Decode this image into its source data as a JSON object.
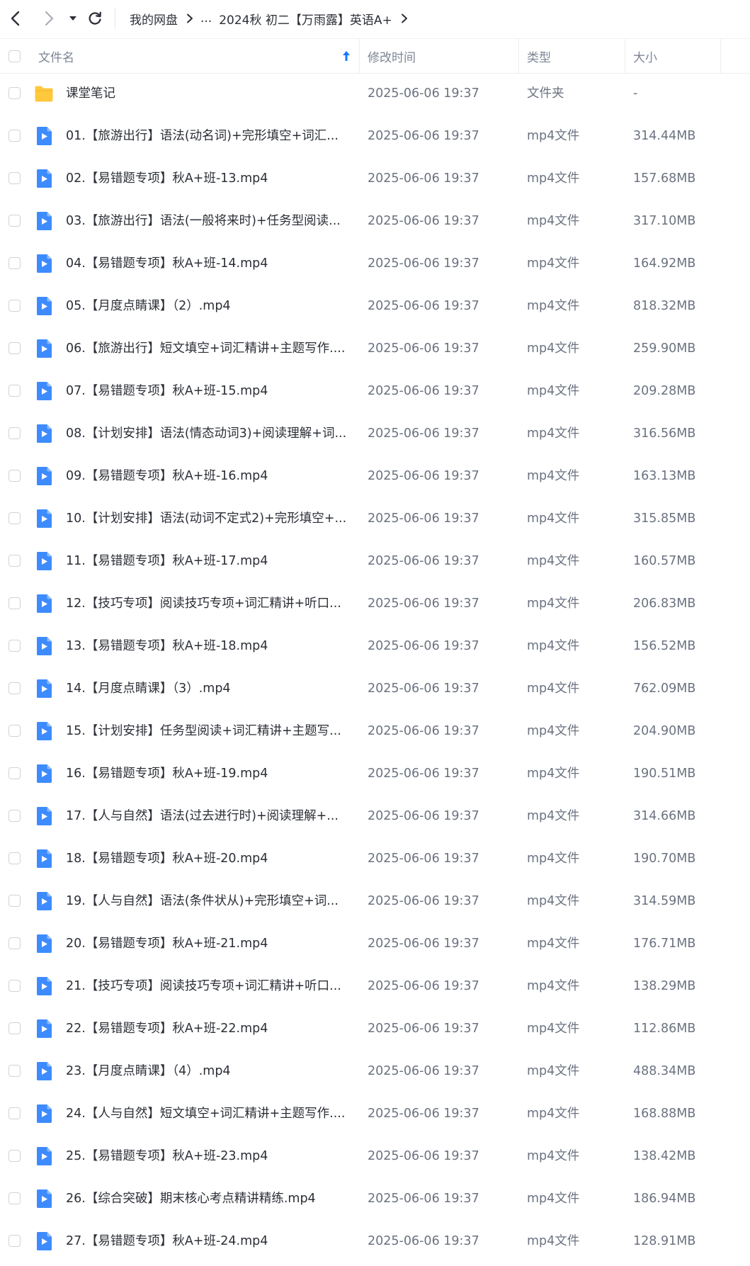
{
  "nav": {
    "back_icon": "chevron-left-icon",
    "forward_icon": "chevron-right-icon",
    "dropdown_icon": "caret-down-icon",
    "refresh_icon": "refresh-icon"
  },
  "breadcrumb": {
    "root": "我的网盘",
    "ellipsis": "...",
    "current": "2024秋 初二【万雨露】英语A+"
  },
  "header": {
    "name": "文件名",
    "modified": "修改时间",
    "type": "类型",
    "size": "大小",
    "sort_icon": "arrow-up-icon"
  },
  "colors": {
    "folder": "#FFC83D",
    "video": "#3D8BFF",
    "sort_arrow": "#1677ff"
  },
  "files": [
    {
      "name": "课堂笔记",
      "time": "2025-06-06 19:37",
      "type": "文件夹",
      "size": "-",
      "icon": "folder-icon"
    },
    {
      "name": "01.【旅游出行】语法(动名词)+完形填空+词汇...",
      "time": "2025-06-06 19:37",
      "type": "mp4文件",
      "size": "314.44MB",
      "icon": "video-file-icon"
    },
    {
      "name": "02.【易错题专项】秋A+班-13.mp4",
      "time": "2025-06-06 19:37",
      "type": "mp4文件",
      "size": "157.68MB",
      "icon": "video-file-icon"
    },
    {
      "name": "03.【旅游出行】语法(一般将来时)+任务型阅读...",
      "time": "2025-06-06 19:37",
      "type": "mp4文件",
      "size": "317.10MB",
      "icon": "video-file-icon"
    },
    {
      "name": "04.【易错题专项】秋A+班-14.mp4",
      "time": "2025-06-06 19:37",
      "type": "mp4文件",
      "size": "164.92MB",
      "icon": "video-file-icon"
    },
    {
      "name": "05.【月度点睛课】（2）.mp4",
      "time": "2025-06-06 19:37",
      "type": "mp4文件",
      "size": "818.32MB",
      "icon": "video-file-icon"
    },
    {
      "name": "06.【旅游出行】短文填空+词汇精讲+主题写作....",
      "time": "2025-06-06 19:37",
      "type": "mp4文件",
      "size": "259.90MB",
      "icon": "video-file-icon"
    },
    {
      "name": "07.【易错题专项】秋A+班-15.mp4",
      "time": "2025-06-06 19:37",
      "type": "mp4文件",
      "size": "209.28MB",
      "icon": "video-file-icon"
    },
    {
      "name": "08.【计划安排】语法(情态动词3)+阅读理解+词...",
      "time": "2025-06-06 19:37",
      "type": "mp4文件",
      "size": "316.56MB",
      "icon": "video-file-icon"
    },
    {
      "name": "09.【易错题专项】秋A+班-16.mp4",
      "time": "2025-06-06 19:37",
      "type": "mp4文件",
      "size": "163.13MB",
      "icon": "video-file-icon"
    },
    {
      "name": "10.【计划安排】语法(动词不定式2)+完形填空+...",
      "time": "2025-06-06 19:37",
      "type": "mp4文件",
      "size": "315.85MB",
      "icon": "video-file-icon"
    },
    {
      "name": "11.【易错题专项】秋A+班-17.mp4",
      "time": "2025-06-06 19:37",
      "type": "mp4文件",
      "size": "160.57MB",
      "icon": "video-file-icon"
    },
    {
      "name": "12.【技巧专项】阅读技巧专项+词汇精讲+听口...",
      "time": "2025-06-06 19:37",
      "type": "mp4文件",
      "size": "206.83MB",
      "icon": "video-file-icon"
    },
    {
      "name": "13.【易错题专项】秋A+班-18.mp4",
      "time": "2025-06-06 19:37",
      "type": "mp4文件",
      "size": "156.52MB",
      "icon": "video-file-icon"
    },
    {
      "name": "14.【月度点睛课】（3）.mp4",
      "time": "2025-06-06 19:37",
      "type": "mp4文件",
      "size": "762.09MB",
      "icon": "video-file-icon"
    },
    {
      "name": "15.【计划安排】任务型阅读+词汇精讲+主题写...",
      "time": "2025-06-06 19:37",
      "type": "mp4文件",
      "size": "204.90MB",
      "icon": "video-file-icon"
    },
    {
      "name": "16.【易错题专项】秋A+班-19.mp4",
      "time": "2025-06-06 19:37",
      "type": "mp4文件",
      "size": "190.51MB",
      "icon": "video-file-icon"
    },
    {
      "name": "17.【人与自然】语法(过去进行时)+阅读理解+...",
      "time": "2025-06-06 19:37",
      "type": "mp4文件",
      "size": "314.66MB",
      "icon": "video-file-icon"
    },
    {
      "name": "18.【易错题专项】秋A+班-20.mp4",
      "time": "2025-06-06 19:37",
      "type": "mp4文件",
      "size": "190.70MB",
      "icon": "video-file-icon"
    },
    {
      "name": "19.【人与自然】语法(条件状从)+完形填空+词...",
      "time": "2025-06-06 19:37",
      "type": "mp4文件",
      "size": "314.59MB",
      "icon": "video-file-icon"
    },
    {
      "name": "20.【易错题专项】秋A+班-21.mp4",
      "time": "2025-06-06 19:37",
      "type": "mp4文件",
      "size": "176.71MB",
      "icon": "video-file-icon"
    },
    {
      "name": "21.【技巧专项】阅读技巧专项+词汇精讲+听口...",
      "time": "2025-06-06 19:37",
      "type": "mp4文件",
      "size": "138.29MB",
      "icon": "video-file-icon"
    },
    {
      "name": "22.【易错题专项】秋A+班-22.mp4",
      "time": "2025-06-06 19:37",
      "type": "mp4文件",
      "size": "112.86MB",
      "icon": "video-file-icon"
    },
    {
      "name": "23.【月度点睛课】（4）.mp4",
      "time": "2025-06-06 19:37",
      "type": "mp4文件",
      "size": "488.34MB",
      "icon": "video-file-icon"
    },
    {
      "name": "24.【人与自然】短文填空+词汇精讲+主题写作....",
      "time": "2025-06-06 19:37",
      "type": "mp4文件",
      "size": "168.88MB",
      "icon": "video-file-icon"
    },
    {
      "name": "25.【易错题专项】秋A+班-23.mp4",
      "time": "2025-06-06 19:37",
      "type": "mp4文件",
      "size": "138.42MB",
      "icon": "video-file-icon"
    },
    {
      "name": "26.【综合突破】期末核心考点精讲精练.mp4",
      "time": "2025-06-06 19:37",
      "type": "mp4文件",
      "size": "186.94MB",
      "icon": "video-file-icon"
    },
    {
      "name": "27.【易错题专项】秋A+班-24.mp4",
      "time": "2025-06-06 19:37",
      "type": "mp4文件",
      "size": "128.91MB",
      "icon": "video-file-icon"
    }
  ]
}
